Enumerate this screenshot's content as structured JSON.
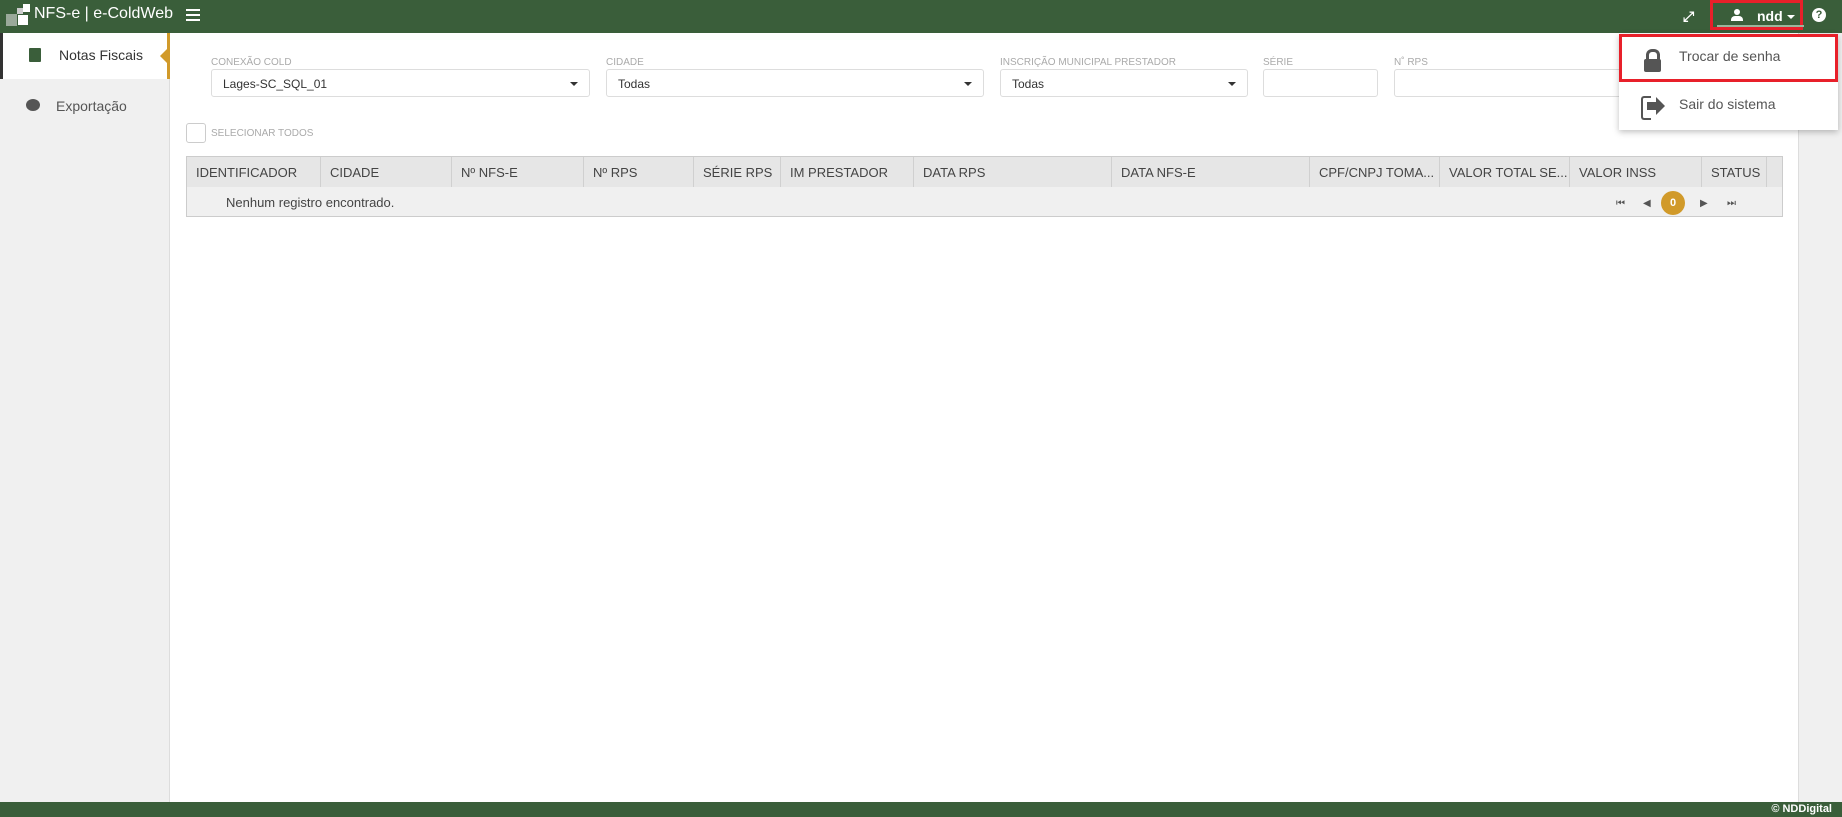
{
  "header": {
    "brand": "NFS-e | e-ColdWeb",
    "username": "ndd",
    "help": "?"
  },
  "sidebar": {
    "items": [
      {
        "label": "Notas Fiscais",
        "active": true,
        "icon": "file-text-icon"
      },
      {
        "label": "Exportação",
        "active": false,
        "icon": "dashboard-icon"
      }
    ]
  },
  "filters": {
    "conexao": {
      "label": "CONEXÃO COLD",
      "value": "Lages-SC_SQL_01"
    },
    "cidade": {
      "label": "CIDADE",
      "value": "Todas"
    },
    "inscricao": {
      "label": "INSCRIÇÃO MUNICIPAL PRESTADOR",
      "value": "Todas"
    },
    "serie": {
      "label": "SÉRIE",
      "value": ""
    },
    "rps": {
      "label": "N˚ RPS",
      "value": ""
    }
  },
  "select_all": "SELECIONAR TODOS",
  "table": {
    "columns": [
      "IDENTIFICADOR",
      "CIDADE",
      "Nº NFS-E",
      "Nº RPS",
      "SÉRIE RPS",
      "IM PRESTADOR",
      "DATA RPS",
      "DATA NFS-E",
      "CPF/CNPJ TOMA...",
      "VALOR TOTAL SE...",
      "VALOR INSS",
      "STATUS"
    ],
    "empty_message": "Nenhum registro encontrado.",
    "page": "0"
  },
  "user_menu": {
    "items": [
      {
        "label": "Trocar de senha",
        "highlighted": true
      },
      {
        "label": "Sair do sistema"
      }
    ]
  },
  "footer": "© NDDigital",
  "colors": {
    "header": "#3a5e3a",
    "accent": "#d19a2a",
    "highlight": "#e8202a"
  }
}
